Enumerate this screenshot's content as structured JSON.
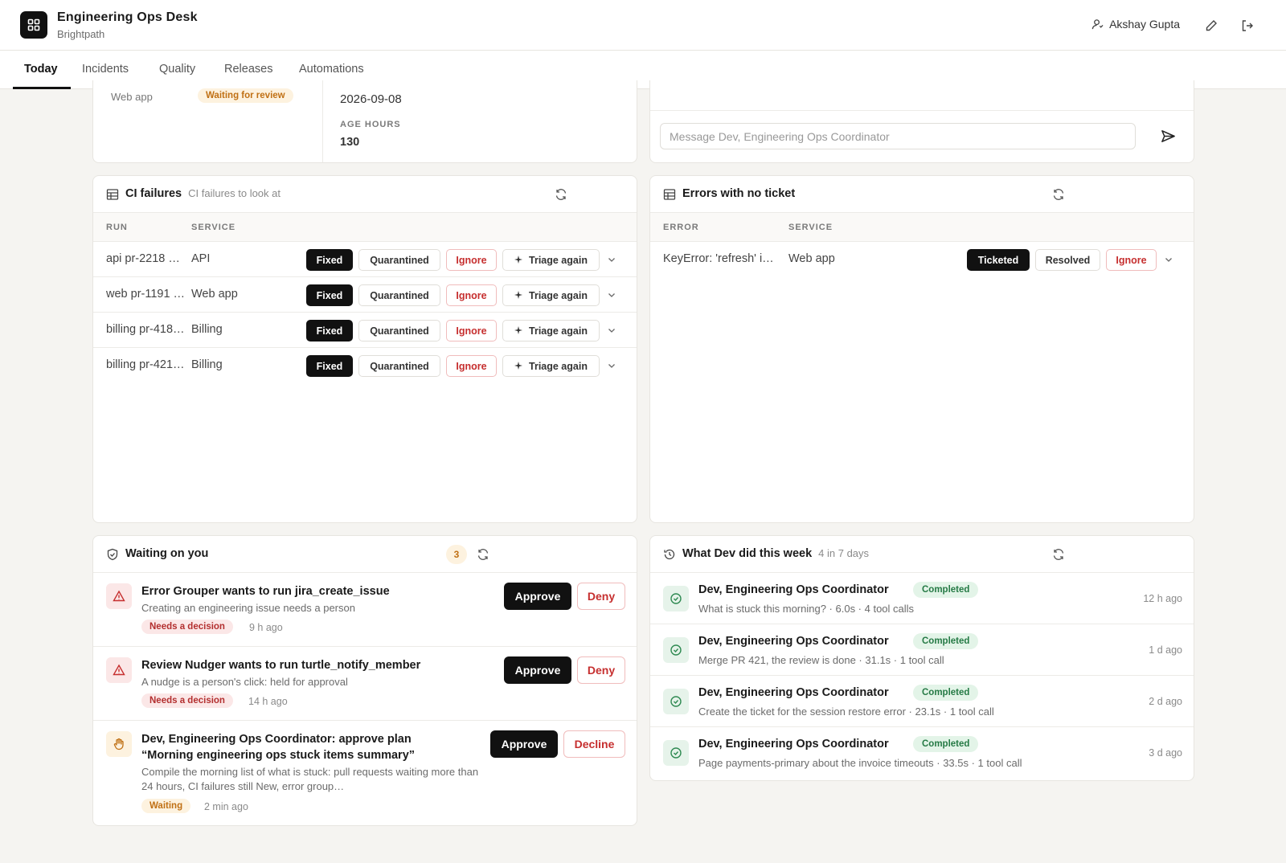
{
  "app": {
    "title": "Engineering Ops Desk",
    "org": "Brightpath",
    "user": "Akshay Gupta"
  },
  "tabs": [
    "Today",
    "Incidents",
    "Quality",
    "Releases",
    "Automations"
  ],
  "review_card": {
    "service": "Web app",
    "status": "Waiting for review",
    "date": "2026-09-08",
    "age_label": "AGE HOURS",
    "age_value": "130"
  },
  "chat": {
    "placeholder": "Message Dev, Engineering Ops Coordinator"
  },
  "ci_failures": {
    "title": "CI failures",
    "subtitle": "CI failures to look at",
    "columns": [
      "RUN",
      "SERVICE"
    ],
    "rows": [
      {
        "run": "api pr-2218 …",
        "service": "API"
      },
      {
        "run": "web pr-1191 …",
        "service": "Web app"
      },
      {
        "run": "billing pr-418…",
        "service": "Billing"
      },
      {
        "run": "billing pr-421…",
        "service": "Billing"
      }
    ],
    "actions": {
      "fixed": "Fixed",
      "quarantined": "Quarantined",
      "ignore": "Ignore",
      "triage": "Triage again"
    }
  },
  "errors": {
    "title": "Errors with no ticket",
    "columns": [
      "ERROR",
      "SERVICE"
    ],
    "rows": [
      {
        "error": "KeyError: 'refresh' i…",
        "service": "Web app"
      }
    ],
    "actions": {
      "ticketed": "Ticketed",
      "resolved": "Resolved",
      "ignore": "Ignore"
    }
  },
  "waiting": {
    "title": "Waiting on you",
    "count": "3",
    "items": [
      {
        "title": "Error Grouper wants to run jira_create_issue",
        "desc": "Creating an engineering issue needs a person",
        "status": "Needs a decision",
        "ago": "9 h ago",
        "approve": "Approve",
        "deny": "Deny"
      },
      {
        "title": "Review Nudger wants to run turtle_notify_member",
        "desc": "A nudge is a person's click: held for approval",
        "status": "Needs a decision",
        "ago": "14 h ago",
        "approve": "Approve",
        "deny": "Deny"
      },
      {
        "title": "Dev, Engineering Ops Coordinator: approve plan “Morning engineering ops stuck items summary”",
        "desc": "Compile the morning list of what is stuck: pull requests waiting more than 24 hours, CI failures still New, error group…",
        "status": "Waiting",
        "ago": "2 min ago",
        "approve": "Approve",
        "deny": "Decline"
      }
    ]
  },
  "activity": {
    "title": "What Dev did this week",
    "subtitle": "4 in 7 days",
    "items": [
      {
        "title": "Dev, Engineering Ops Coordinator",
        "badge": "Completed",
        "desc": "What is stuck this morning? · 6.0s · 4 tool calls",
        "ago": "12 h ago"
      },
      {
        "title": "Dev, Engineering Ops Coordinator",
        "badge": "Completed",
        "desc": "Merge PR 421, the review is done · 31.1s · 1 tool call",
        "ago": "1 d ago"
      },
      {
        "title": "Dev, Engineering Ops Coordinator",
        "badge": "Completed",
        "desc": "Create the ticket for the session restore error · 23.1s · 1 tool call",
        "ago": "2 d ago"
      },
      {
        "title": "Dev, Engineering Ops Coordinator",
        "badge": "Completed",
        "desc": "Page payments-primary about the invoice timeouts · 33.5s · 1 tool call",
        "ago": "3 d ago"
      }
    ]
  }
}
